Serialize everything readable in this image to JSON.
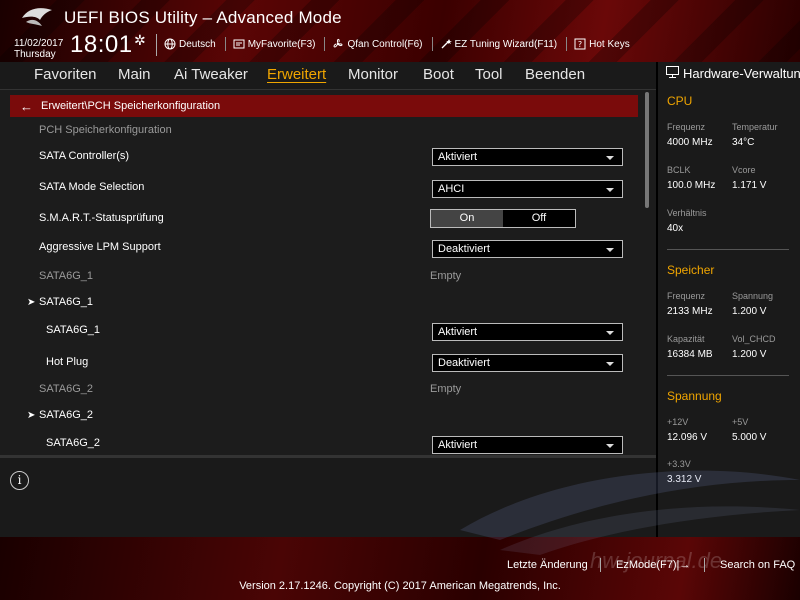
{
  "header": {
    "title": "UEFI BIOS Utility – Advanced Mode",
    "date": "11/02/2017",
    "day": "Thursday",
    "time": "18:01",
    "toolbar": [
      {
        "label": "Deutsch",
        "icon": "globe-icon"
      },
      {
        "label": "MyFavorite(F3)",
        "icon": "favorite-icon"
      },
      {
        "label": "Qfan Control(F6)",
        "icon": "fan-icon"
      },
      {
        "label": "EZ Tuning Wizard(F11)",
        "icon": "wizard-icon"
      },
      {
        "label": "Hot Keys",
        "icon": "hotkeys-icon"
      }
    ]
  },
  "menu": {
    "items": [
      "Favoriten",
      "Main",
      "Ai Tweaker",
      "Erweitert",
      "Monitor",
      "Boot",
      "Tool",
      "Beenden"
    ],
    "active": "Erweitert"
  },
  "main": {
    "breadcrumb": "Erweitert\\PCH Speicherkonfiguration",
    "section_title": "PCH Speicherkonfiguration",
    "rows": {
      "sata_controller": {
        "label": "SATA Controller(s)",
        "value": "Aktiviert"
      },
      "sata_mode": {
        "label": "SATA Mode Selection",
        "value": "AHCI"
      },
      "smart": {
        "label": "S.M.A.R.T.-Statusprüfung",
        "on": "On",
        "off": "Off"
      },
      "lpm": {
        "label": "Aggressive LPM Support",
        "value": "Deaktiviert"
      },
      "sata1_status": {
        "label": "SATA6G_1",
        "value": "Empty"
      },
      "sata1_group": {
        "label": "SATA6G_1"
      },
      "sata1_enable": {
        "label": "SATA6G_1",
        "value": "Aktiviert"
      },
      "sata1_hotplug": {
        "label": "Hot Plug",
        "value": "Deaktiviert"
      },
      "sata2_status": {
        "label": "SATA6G_2",
        "value": "Empty"
      },
      "sata2_group": {
        "label": "SATA6G_2"
      },
      "sata2_enable": {
        "label": "SATA6G_2",
        "value": "Aktiviert"
      }
    }
  },
  "hw": {
    "title": "Hardware-Verwaltung",
    "cpu": {
      "title": "CPU",
      "freq_label": "Frequenz",
      "freq_value": "4000 MHz",
      "temp_label": "Temperatur",
      "temp_value": "34°C",
      "bclk_label": "BCLK",
      "bclk_value": "100.0 MHz",
      "vcore_label": "Vcore",
      "vcore_value": "1.171 V",
      "ratio_label": "Verhältnis",
      "ratio_value": "40x"
    },
    "mem": {
      "title": "Speicher",
      "freq_label": "Frequenz",
      "freq_value": "2133 MHz",
      "volt_label": "Spannung",
      "volt_value": "1.200 V",
      "cap_label": "Kapazität",
      "cap_value": "16384 MB",
      "vol_label": "Vol_CHCD",
      "vol_value": "1.200 V"
    },
    "volt": {
      "title": "Spannung",
      "v12_label": "+12V",
      "v12_value": "12.096 V",
      "v5_label": "+5V",
      "v5_value": "5.000 V",
      "v33_label": "+3.3V",
      "v33_value": "3.312 V"
    }
  },
  "footer": {
    "last_change": "Letzte Änderung",
    "ezmode": "EzMode(F7)|→",
    "search": "Search on FAQ",
    "version": "Version 2.17.1246. Copyright (C) 2017 American Megatrends, Inc.",
    "watermark": "hw-journal.de"
  },
  "colors": {
    "accent": "#f0a500",
    "header_red": "#7a0b0b",
    "panel": "#1c1c1c"
  }
}
